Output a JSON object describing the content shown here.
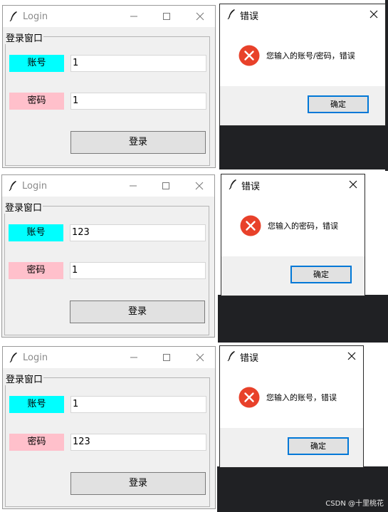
{
  "login": {
    "title": "Login",
    "group_label": "登录窗口",
    "account_label": "账号",
    "password_label": "密码",
    "login_button": "登录"
  },
  "dialog": {
    "title": "错误",
    "ok_button": "确定"
  },
  "panels": [
    {
      "account_value": "1",
      "password_value": "1",
      "message": "您输入的账号/密码，错误"
    },
    {
      "account_value": "123",
      "password_value": "1",
      "message": "您输入的密码，错误"
    },
    {
      "account_value": "1",
      "password_value": "123",
      "message": "您输入的账号，错误"
    }
  ],
  "watermark": "CSDN @十里桃花",
  "colors": {
    "account_label_bg": "#00ffff",
    "password_label_bg": "#ffc0cb",
    "error_icon": "#e8412a",
    "dialog_button_border": "#0078d7",
    "desktop": "#202124"
  },
  "icons": [
    "feather-icon",
    "minimize-icon",
    "maximize-icon",
    "close-icon",
    "error-icon"
  ]
}
